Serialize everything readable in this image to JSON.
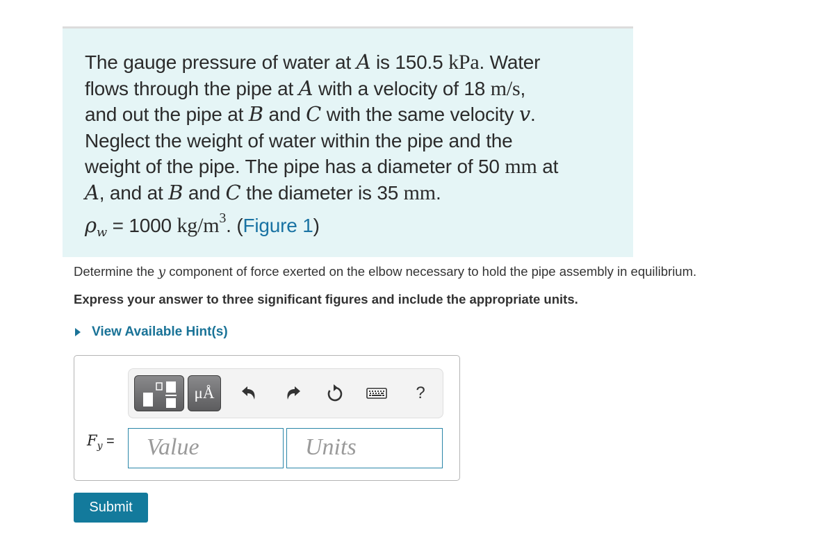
{
  "problem": {
    "line1": {
      "t1": "The gauge pressure of water at ",
      "A": "A",
      "t2": " is 150.5 ",
      "kPa": "kPa",
      "t3": ". Water"
    },
    "line2": {
      "t1": "flows through the pipe at ",
      "A": "A",
      "t2": " with a velocity of 18 ",
      "ms": "m/s",
      "t3": ","
    },
    "line3": {
      "t1": "and out the pipe at ",
      "B": "B",
      "t2": " and ",
      "C": "C",
      "t3": " with the same velocity ",
      "v": "v",
      "t4": "."
    },
    "line4": "Neglect the weight of water within the pipe and the",
    "line5": {
      "t1": "weight of the pipe. The pipe has a diameter of 50 ",
      "mm": "mm",
      "t2": " at"
    },
    "line6": {
      "A": "A",
      "t1": ", and at ",
      "B": "B",
      "t2": " and ",
      "C": "C",
      "t3": " the diameter is 35 ",
      "mm": "mm",
      "t4": "."
    },
    "line7": {
      "rho": "ρ",
      "w": "w",
      "t1": " = 1000 ",
      "unit": "kg/m",
      "exp": "3",
      "t2": ". (",
      "figure_link": "Figure 1",
      "t3": ")"
    }
  },
  "question": {
    "t1": "Determine the ",
    "y": "y",
    "t2": " component of force exerted on the elbow necessary to hold the pipe assembly in equilibrium."
  },
  "instruction": "Express your answer to three significant figures and include the appropriate units.",
  "hint_label": "View Available Hint(s)",
  "toolbar": {
    "templates_icon": "templates-icon",
    "units_label": "μÅ",
    "undo_icon": "undo-icon",
    "redo_icon": "redo-icon",
    "reset_icon": "reset-icon",
    "keyboard_icon": "keyboard-icon",
    "help_label": "?"
  },
  "answer": {
    "label_F": "F",
    "label_sub": "y",
    "label_eq": " =",
    "value_placeholder": "Value",
    "units_placeholder": "Units"
  },
  "submit_label": "Submit",
  "colors": {
    "accent": "#137a9c",
    "link": "#1a73a3",
    "problem_bg": "#e5f5f6"
  }
}
